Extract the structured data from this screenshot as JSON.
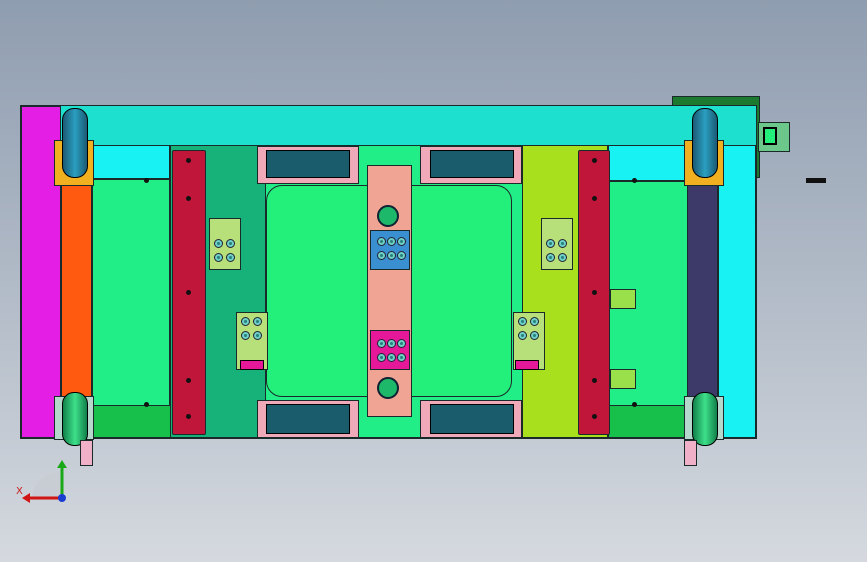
{
  "viewport": {
    "background": "#a9b3c0"
  },
  "axis_triad": {
    "x_label": "X",
    "x_color": "#d11414",
    "y_color": "#18a818",
    "z_color": "#1a3cd1"
  },
  "colors": {
    "frame_top": "#1ee0cf",
    "plate": "#22ee88",
    "left_strip_magenta": "#e51ee5",
    "left_strip_orange": "#ff5a10",
    "right_strip_navy": "#3d3a6a",
    "right_strip_cyan": "#19f2f2",
    "rail_red": "#c0163a",
    "pocket": "#22f07a",
    "center_bar": "#f0a494",
    "plate_left_zone": "#16b27a",
    "plate_right_zone": "#a8e01e",
    "slot": "#1a5c6c",
    "control_box": "#1b7a30"
  },
  "icons": {
    "caster": "caster-wheel-icon",
    "clamp": "clamp-block-icon",
    "axis": "axis-triad-icon"
  }
}
